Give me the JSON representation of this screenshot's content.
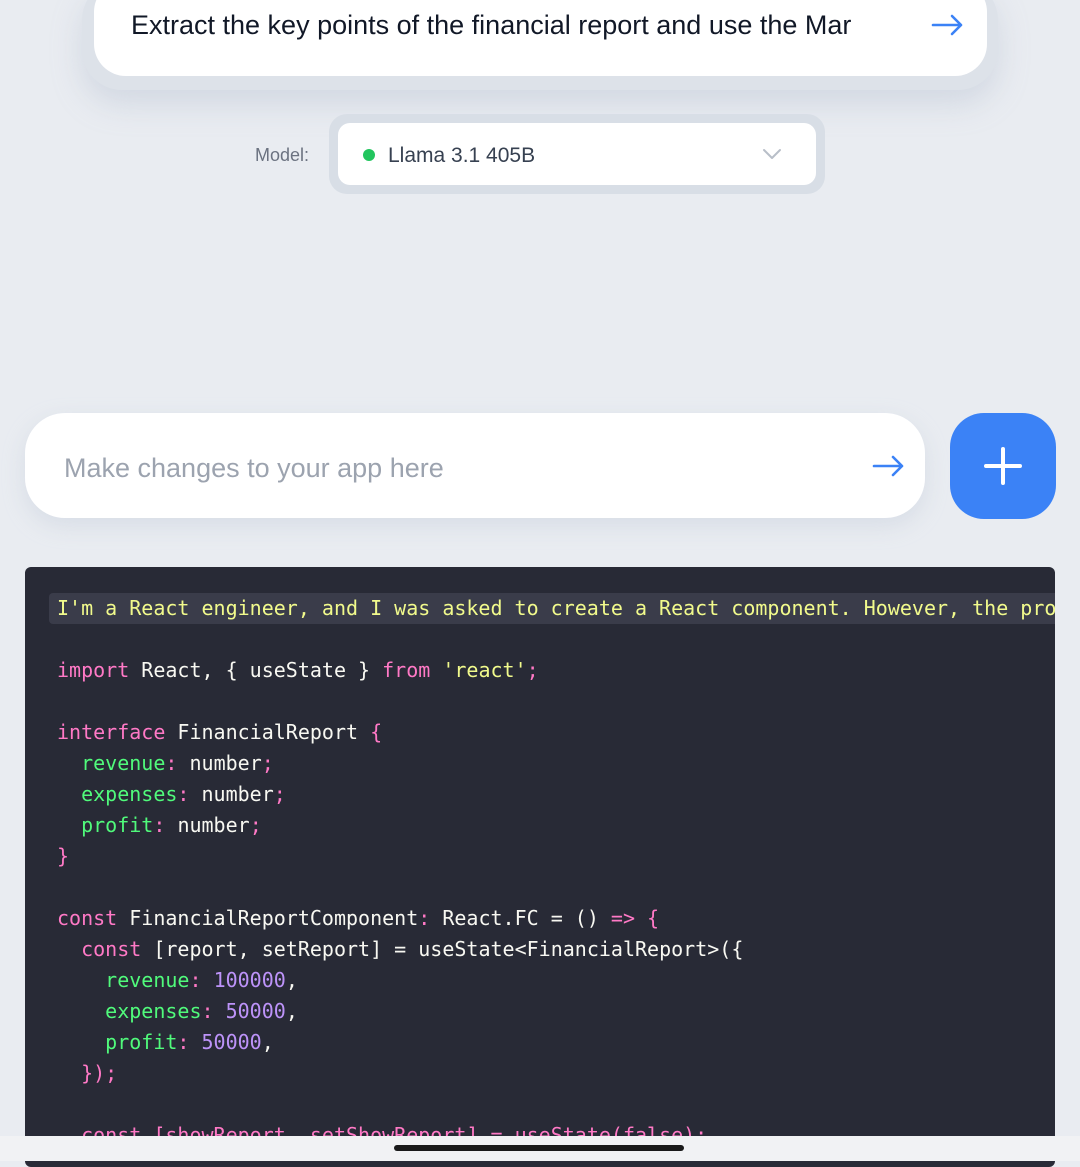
{
  "prompt": {
    "text": "Extract the key points of the financial report and use the Mar",
    "submit_icon": "arrow-right-icon"
  },
  "model": {
    "label": "Model:",
    "selected": "Llama 3.1 405B",
    "status_color": "#22c55e"
  },
  "change_input": {
    "placeholder": "Make changes to your app here",
    "value": ""
  },
  "new_button_icon": "plus-icon",
  "colors": {
    "accent": "#3b82f6",
    "code_bg": "#282a36"
  },
  "code": {
    "first_line": "I'm a React engineer, and I was asked to create a React component. However, the pro",
    "import_kw": "import",
    "import_mid": " React, { useState } ",
    "from_kw": "from",
    "import_src": "'react'",
    "interface_kw": "interface",
    "interface_name": " FinancialReport ",
    "prop_revenue": "revenue",
    "prop_expenses": "expenses",
    "prop_profit": "profit",
    "type_number": "number",
    "const_kw": "const",
    "component_decl": " FinancialReportComponent",
    "component_type": " React.FC = () ",
    "state_decl": " [report, setReport] = useState<FinancialReport>({",
    "revenue_value": "100000",
    "expenses_value": "50000",
    "profit_value": "50000",
    "close_state": "});",
    "cut_line": "const [showReport, setShowReport] = useState(false);"
  }
}
